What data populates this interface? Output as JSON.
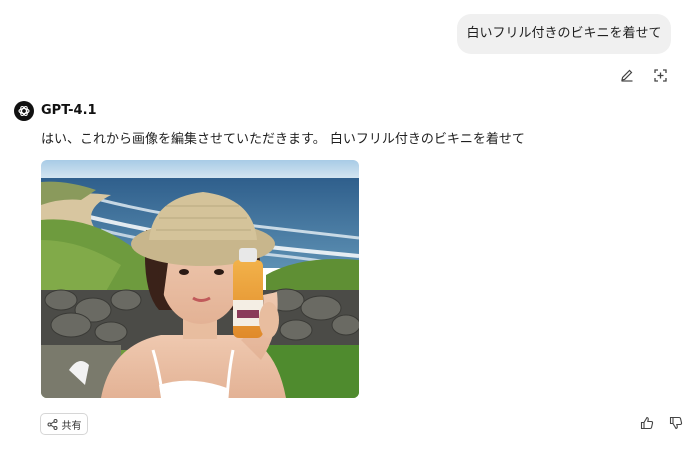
{
  "user_message": {
    "text": "白いフリル付きのビキニを着せて"
  },
  "assistant": {
    "model_name": "GPT-4.1",
    "message": "はい、これから画像を編集させていただきます。 白いフリル付きのビキニを着せて",
    "avatar_icon": "openai-logo-icon"
  },
  "actions": {
    "share_label": "共有",
    "edit_icon": "pencil-icon",
    "branch_icon": "edit-image-icon",
    "like_icon": "thumbs-up-icon",
    "dislike_icon": "thumbs-down-icon",
    "share_icon": "share-icon"
  },
  "colors": {
    "bubble_bg": "#f0f0f0",
    "sea": "#3c6f9a",
    "sky": "#b9d6ea",
    "grass": "#6a9a3a"
  }
}
